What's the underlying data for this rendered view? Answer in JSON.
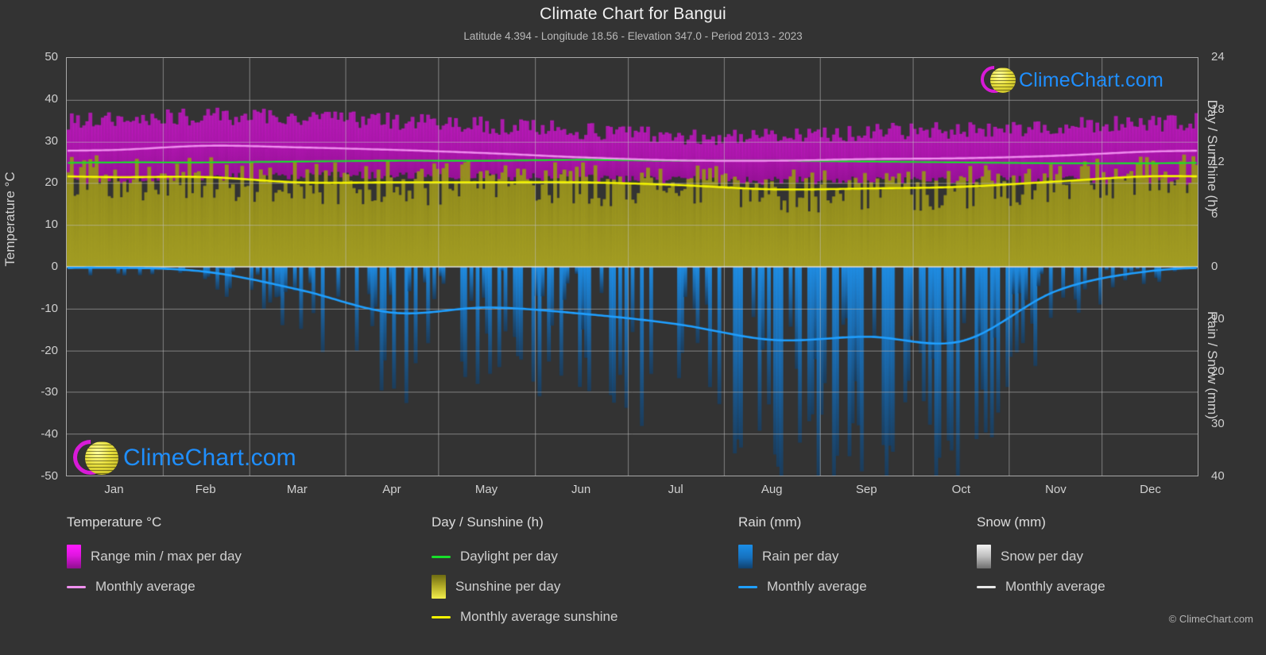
{
  "header": {
    "title": "Climate Chart for Bangui",
    "subtitle": "Latitude 4.394 - Longitude 18.56 - Elevation 347.0 - Period 2013 - 2023"
  },
  "axes": {
    "y_left_title": "Temperature °C",
    "y_right_top_title": "Day / Sunshine (h)",
    "y_right_bottom_title": "Rain / Snow (mm)",
    "y_left_ticks": [
      "50",
      "40",
      "30",
      "20",
      "10",
      "0",
      "-10",
      "-20",
      "-30",
      "-40",
      "-50"
    ],
    "y_right_top_ticks": [
      "24",
      "18",
      "12",
      "6",
      "0"
    ],
    "y_right_bottom_ticks": [
      "0",
      "10",
      "20",
      "30",
      "40"
    ],
    "x_ticks": [
      "Jan",
      "Feb",
      "Mar",
      "Apr",
      "May",
      "Jun",
      "Jul",
      "Aug",
      "Sep",
      "Oct",
      "Nov",
      "Dec"
    ]
  },
  "branding": {
    "wordmark": "ClimeChart.com",
    "copyright": "© ClimeChart.com"
  },
  "legend": {
    "temperature": {
      "heading": "Temperature °C",
      "items": [
        {
          "label": "Range min / max per day",
          "marker": "range-swatch",
          "color": "#e016e0"
        },
        {
          "label": "Monthly average",
          "marker": "line",
          "color": "#f090ef"
        }
      ]
    },
    "day_sunshine": {
      "heading": "Day / Sunshine (h)",
      "items": [
        {
          "label": "Daylight per day",
          "marker": "line",
          "color": "#17e02a"
        },
        {
          "label": "Sunshine per day",
          "marker": "range-swatch",
          "color": "#b5ae28"
        },
        {
          "label": "Monthly average sunshine",
          "marker": "line",
          "color": "#f4f400"
        }
      ]
    },
    "rain": {
      "heading": "Rain (mm)",
      "items": [
        {
          "label": "Rain per day",
          "marker": "range-swatch",
          "color": "#1670bd"
        },
        {
          "label": "Monthly average",
          "marker": "line",
          "color": "#1f9fff"
        }
      ]
    },
    "snow": {
      "heading": "Snow (mm)",
      "items": [
        {
          "label": "Snow per day",
          "marker": "range-swatch",
          "color": "#bdbdbd"
        },
        {
          "label": "Monthly average",
          "marker": "line",
          "color": "#e8e8e8"
        }
      ]
    }
  },
  "chart_data": {
    "type": "area",
    "title": "Climate Chart for Bangui",
    "subtitle": "Latitude 4.394 - Longitude 18.56 - Elevation 347.0 - Period 2013 - 2023",
    "xlabel": "",
    "ylabel": "Temperature °C",
    "ylim": [
      -50,
      50
    ],
    "y2_top_label": "Day / Sunshine (h)",
    "y2_top_lim": [
      0,
      24
    ],
    "y2_bottom_label": "Rain / Snow (mm)",
    "y2_bottom_lim": [
      0,
      40
    ],
    "grid": true,
    "legend_position": "below",
    "categories": [
      "Jan",
      "Feb",
      "Mar",
      "Apr",
      "May",
      "Jun",
      "Jul",
      "Aug",
      "Sep",
      "Oct",
      "Nov",
      "Dec"
    ],
    "series": [
      {
        "name": "Temperature monthly average (°C)",
        "color": "#f090ef",
        "values": [
          28.0,
          29.0,
          28.6,
          28.0,
          27.2,
          26.2,
          25.5,
          25.4,
          25.8,
          26.0,
          26.6,
          27.6
        ]
      },
      {
        "name": "Temperature daily max (°C, typical)",
        "color": "#e016e0",
        "values": [
          35.0,
          35.8,
          35.5,
          34.6,
          33.6,
          32.4,
          31.2,
          31.0,
          32.0,
          32.6,
          33.4,
          34.2
        ]
      },
      {
        "name": "Temperature daily min (°C, typical)",
        "color": "#e016e0",
        "values": [
          20.6,
          21.4,
          21.8,
          21.8,
          21.6,
          21.2,
          20.8,
          20.6,
          20.8,
          20.8,
          20.8,
          20.6
        ]
      },
      {
        "name": "Daylight per day (h)",
        "color": "#17e02a",
        "values": [
          12.0,
          12.0,
          12.1,
          12.2,
          12.2,
          12.3,
          12.2,
          12.2,
          12.1,
          12.0,
          11.9,
          11.9
        ]
      },
      {
        "name": "Monthly average sunshine (h)",
        "color": "#f4f400",
        "values": [
          10.3,
          10.3,
          9.7,
          9.7,
          9.7,
          9.7,
          9.4,
          8.9,
          9.0,
          9.2,
          9.8,
          10.4
        ]
      },
      {
        "name": "Rain monthly average (mm/day)",
        "color": "#1f9fff",
        "values": [
          0.2,
          1.0,
          4.4,
          8.8,
          7.8,
          9.0,
          11.0,
          14.0,
          13.4,
          14.2,
          4.6,
          0.8
        ]
      },
      {
        "name": "Snow monthly average (mm/day)",
        "color": "#e8e8e8",
        "values": [
          0,
          0,
          0,
          0,
          0,
          0,
          0,
          0,
          0,
          0,
          0,
          0
        ]
      }
    ],
    "notes": "Daily min/max temperature range shown as magenta vertical bars; sunshine hours as olive/yellow bars rising from 0; rain per day as blue bars descending from 0 on the inverted lower scale; no snow recorded."
  }
}
